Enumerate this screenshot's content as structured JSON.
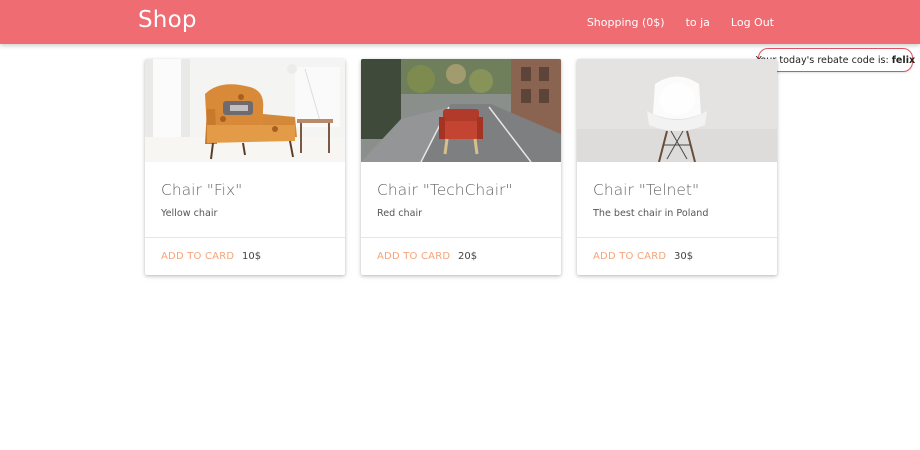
{
  "navbar": {
    "brand": "Shop",
    "links": [
      {
        "label": "Shopping (0$)"
      },
      {
        "label": "to ja"
      },
      {
        "label": "Log Out"
      }
    ],
    "color": "#ef6c73"
  },
  "rebate": {
    "text": "Your today's rebate code is:",
    "code": "felix"
  },
  "products": [
    {
      "title": "Chair \"Fix\"",
      "description": "Yellow chair",
      "button": "ADD TO CARD",
      "price": "10$",
      "image": "armchair-in-living-room"
    },
    {
      "title": "Chair \"TechChair\"",
      "description": "Red chair",
      "button": "ADD TO CARD",
      "price": "20$",
      "image": "red-chair-on-street"
    },
    {
      "title": "Chair \"Telnet\"",
      "description": "The best chair in Poland",
      "button": "ADD TO CARD",
      "price": "30$",
      "image": "white-chair-on-grey"
    }
  ],
  "colors": {
    "accent": "#f4a47a",
    "rebate_border": "#e05263"
  }
}
